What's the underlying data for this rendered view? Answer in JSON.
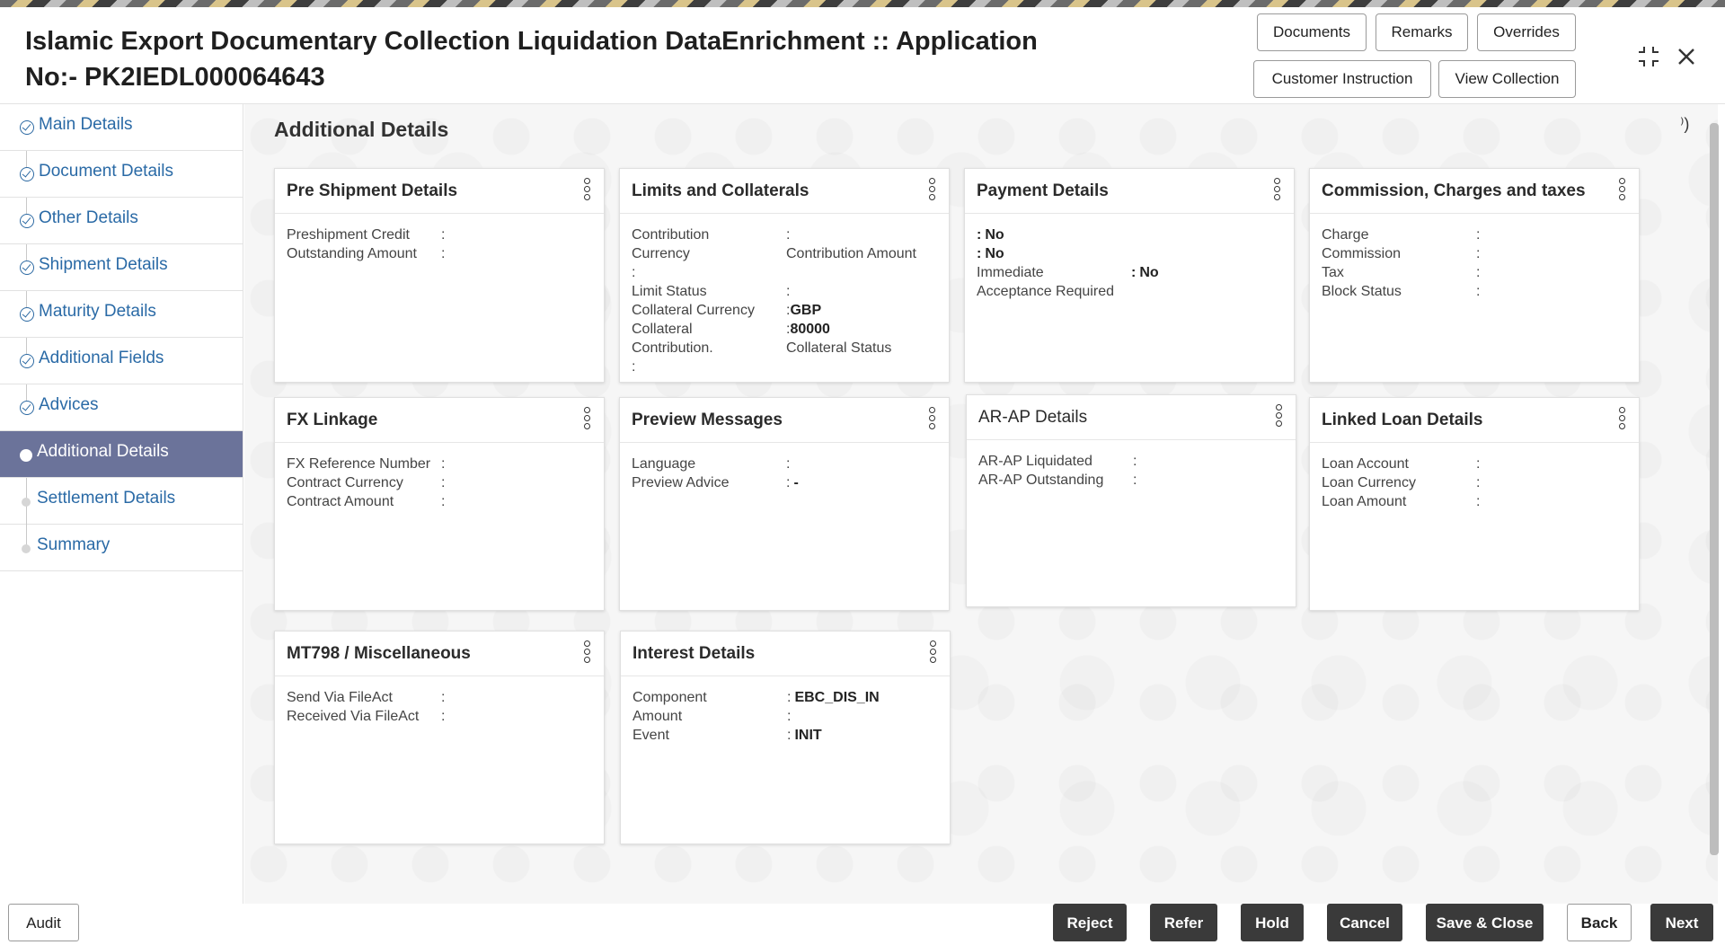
{
  "header": {
    "title": "Islamic Export Documentary Collection Liquidation DataEnrichment :: Application No:- PK2IEDL000064643",
    "buttons": {
      "documents": "Documents",
      "remarks": "Remarks",
      "overrides": "Overrides",
      "customer_instruction": "Customer Instruction",
      "view_collection": "View Collection"
    },
    "icons": {
      "collapse": "collapse-icon",
      "close": "close-icon"
    }
  },
  "sidebar": {
    "items": [
      {
        "label": "Main Details",
        "state": "done"
      },
      {
        "label": "Document Details",
        "state": "done"
      },
      {
        "label": "Other Details",
        "state": "done"
      },
      {
        "label": "Shipment Details",
        "state": "done"
      },
      {
        "label": "Maturity Details",
        "state": "done"
      },
      {
        "label": "Additional Fields",
        "state": "done"
      },
      {
        "label": "Advices",
        "state": "done"
      },
      {
        "label": "Additional Details",
        "state": "active"
      },
      {
        "label": "Settlement Details",
        "state": "pending"
      },
      {
        "label": "Summary",
        "state": "pending"
      }
    ]
  },
  "main": {
    "title": "Additional Details",
    "corner_glyph": "⁾)",
    "cards": {
      "pre_shipment": {
        "title": "Pre Shipment Details",
        "rows": [
          {
            "k": "Preshipment Credit",
            "sep": ":",
            "v": ""
          },
          {
            "k": "Outstanding Amount",
            "sep": ":",
            "v": ""
          }
        ]
      },
      "limits": {
        "title": "Limits and Collaterals",
        "rows": [
          {
            "k": "Contribution",
            "sep": ":",
            "v": ""
          },
          {
            "k": "Currency",
            "sep": "",
            "v": "Contribution Amount"
          },
          {
            "k": ":",
            "sep": "",
            "v": ""
          },
          {
            "k": "Limit Status",
            "sep": ":",
            "v": ""
          },
          {
            "k": "Collateral Currency",
            "sep": ":",
            "v": "GBP"
          },
          {
            "k": "Collateral",
            "sep": ":",
            "v": "80000"
          },
          {
            "k": "Contribution.",
            "sep": "",
            "v": "Collateral Status"
          },
          {
            "k": ":",
            "sep": "",
            "v": ""
          }
        ]
      },
      "payment": {
        "title": "Payment Details",
        "rows": [
          {
            "k": "",
            "sep": ":",
            "v": "No"
          },
          {
            "k": "",
            "sep": ":",
            "v": "No"
          },
          {
            "k": "Immediate",
            "sep": ":",
            "v": "No"
          },
          {
            "k": "Acceptance Required",
            "sep": "",
            "v": ""
          }
        ]
      },
      "commission": {
        "title": "Commission, Charges and taxes",
        "rows": [
          {
            "k": "Charge",
            "sep": ":",
            "v": ""
          },
          {
            "k": "Commission",
            "sep": ":",
            "v": ""
          },
          {
            "k": "Tax",
            "sep": ":",
            "v": ""
          },
          {
            "k": "Block Status",
            "sep": ":",
            "v": ""
          }
        ]
      },
      "fx": {
        "title": "FX Linkage",
        "rows": [
          {
            "k": "FX Reference Number",
            "sep": ":",
            "v": ""
          },
          {
            "k": "Contract Currency",
            "sep": ":",
            "v": ""
          },
          {
            "k": "Contract Amount",
            "sep": ":",
            "v": ""
          }
        ]
      },
      "preview": {
        "title": "Preview Messages",
        "rows": [
          {
            "k": "Language",
            "sep": ":",
            "v": ""
          },
          {
            "k": "Preview Advice",
            "sep": ":",
            "v": "-"
          }
        ]
      },
      "arap": {
        "title": "AR-AP Details",
        "rows": [
          {
            "k": "AR-AP Liquidated",
            "sep": ":",
            "v": ""
          },
          {
            "k": "AR-AP Outstanding",
            "sep": ":",
            "v": ""
          }
        ]
      },
      "linked_loan": {
        "title": "Linked Loan Details",
        "rows": [
          {
            "k": "Loan Account",
            "sep": ":",
            "v": ""
          },
          {
            "k": "Loan Currency",
            "sep": ":",
            "v": ""
          },
          {
            "k": "Loan Amount",
            "sep": ":",
            "v": ""
          }
        ]
      },
      "mt798": {
        "title": "MT798 / Miscellaneous",
        "rows": [
          {
            "k": "Send Via FileAct",
            "sep": ":",
            "v": ""
          },
          {
            "k": "Received Via FileAct",
            "sep": ":",
            "v": ""
          }
        ]
      },
      "interest": {
        "title": "Interest Details",
        "rows": [
          {
            "k": "Component",
            "sep": ":",
            "v": "EBC_DIS_IN"
          },
          {
            "k": "Amount",
            "sep": ":",
            "v": ""
          },
          {
            "k": "Event",
            "sep": ":",
            "v": "INIT"
          }
        ]
      }
    }
  },
  "footer": {
    "audit": "Audit",
    "reject": "Reject",
    "refer": "Refer",
    "hold": "Hold",
    "cancel": "Cancel",
    "save_close": "Save & Close",
    "back": "Back",
    "next": "Next"
  }
}
